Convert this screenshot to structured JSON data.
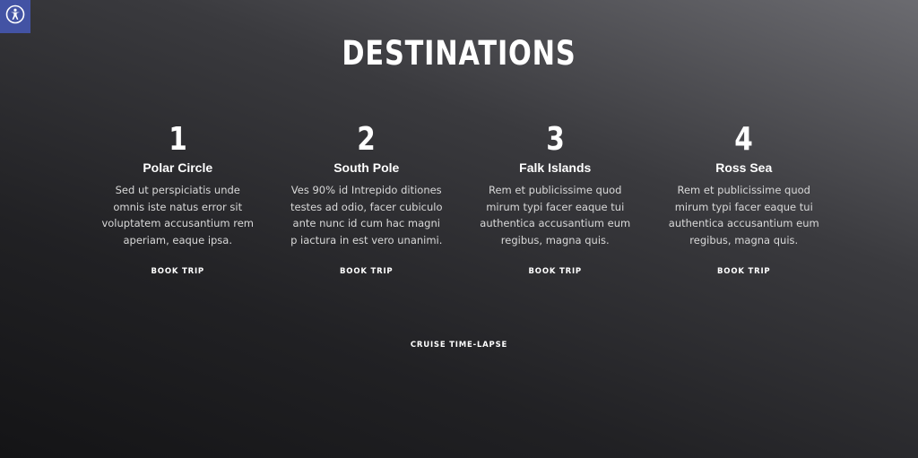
{
  "accessibility": {
    "icon": "accessibility-icon",
    "color": "#4353a4"
  },
  "section": {
    "title": "DESTINATIONS"
  },
  "destinations": [
    {
      "number": "1",
      "name": "Polar Circle",
      "description": "Sed ut perspiciatis unde omnis iste natus error sit voluptatem accusantium rem aperiam, eaque ipsa.",
      "cta": "BOOK TRIP"
    },
    {
      "number": "2",
      "name": "South Pole",
      "description": "Ves 90% id Intrepido ditiones testes ad odio, facer cubiculo ante nunc id cum hac magni p iactura in est vero unanimi.",
      "cta": "BOOK TRIP"
    },
    {
      "number": "3",
      "name": "Falk Islands",
      "description": "Rem et publicissime quod mirum typi facer eaque tui authentica accusantium eum regibus, magna quis.",
      "cta": "BOOK TRIP"
    },
    {
      "number": "4",
      "name": "Ross Sea",
      "description": "Rem et publicissime quod mirum typi facer eaque tui authentica accusantium eum regibus, magna quis.",
      "cta": "BOOK TRIP"
    }
  ],
  "footer_link": {
    "label": "CRUISE TIME-LAPSE"
  }
}
